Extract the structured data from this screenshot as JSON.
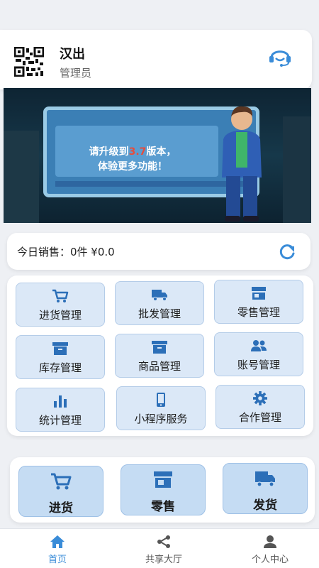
{
  "status_bar": {
    "text": ""
  },
  "profile": {
    "name": "汉出",
    "role": "管理员",
    "qr_icon": "qr-code-icon",
    "support_icon": "customer-service-icon"
  },
  "banner": {
    "line1_prefix": "请升级到",
    "line1_version": "3.7",
    "line1_suffix": "版本，",
    "line2": "体验更多功能！"
  },
  "sales": {
    "text": "今日销售：0件  ¥0.0",
    "refresh_icon": "refresh-icon"
  },
  "menu": [
    {
      "label": "进货管理",
      "icon": "cart-icon"
    },
    {
      "label": "批发管理",
      "icon": "truck-icon"
    },
    {
      "label": "零售管理",
      "icon": "store-icon"
    },
    {
      "label": "库存管理",
      "icon": "archive-box-icon"
    },
    {
      "label": "商品管理",
      "icon": "archive-box-icon"
    },
    {
      "label": "账号管理",
      "icon": "users-icon"
    },
    {
      "label": "统计管理",
      "icon": "bar-chart-icon"
    },
    {
      "label": "小程序服务",
      "icon": "phone-icon"
    },
    {
      "label": "合作管理",
      "icon": "gear-icon"
    }
  ],
  "quick": [
    {
      "label": "进货",
      "icon": "cart-icon"
    },
    {
      "label": "零售",
      "icon": "store-icon"
    },
    {
      "label": "发货",
      "icon": "truck-icon"
    }
  ],
  "tabs": [
    {
      "label": "首页",
      "icon": "home-icon",
      "active": true
    },
    {
      "label": "共享大厅",
      "icon": "share-icon",
      "active": false
    },
    {
      "label": "个人中心",
      "icon": "user-icon",
      "active": false
    }
  ],
  "colors": {
    "accent": "#3a8cd8",
    "icon_blue": "#2c6fb8",
    "menu_bg": "#dbe8f7",
    "quick_bg": "#c5dcf3",
    "version_red": "#e74c3c"
  }
}
